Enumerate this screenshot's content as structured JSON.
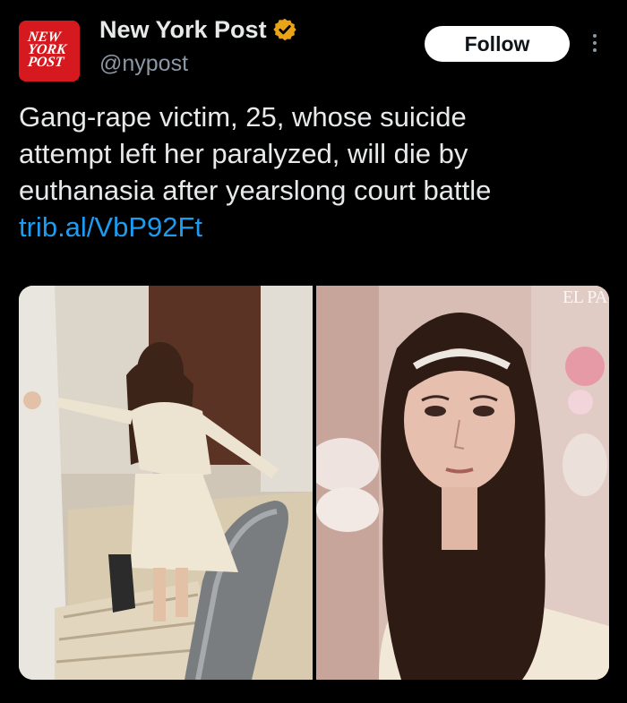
{
  "account": {
    "display_name": "New York Post",
    "handle": "@nypost",
    "verified": true,
    "avatar_logo": [
      "NEW",
      "YORK",
      "POST"
    ]
  },
  "actions": {
    "follow_label": "Follow",
    "more_icon": "more-vertical-icon"
  },
  "tweet": {
    "lines": [
      "Gang-rape victim, 25, whose suicide",
      "attempt left her paralyzed, will die by",
      "euthanasia after yearslong court battle"
    ],
    "link": "trib.al/VbP92Ft"
  },
  "media": {
    "watermark": "EL PA"
  },
  "colors": {
    "background": "#000000",
    "text": "#e7e9ea",
    "secondary_text": "#8b98a5",
    "link": "#1d9bf0",
    "avatar": "#d6191f",
    "verified_badge": "#e8a317"
  }
}
